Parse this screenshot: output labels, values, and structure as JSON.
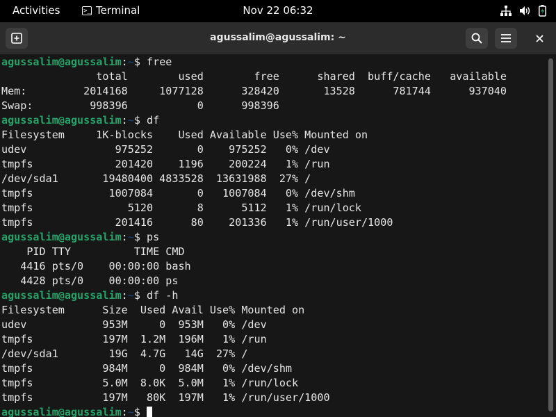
{
  "topbar": {
    "activities": "Activities",
    "app_name": "Terminal",
    "app_icon_glyph": ">_",
    "clock": "Nov 22  06:32",
    "icons": [
      "network-icon",
      "volume-icon",
      "battery-icon"
    ]
  },
  "window": {
    "title": "agussalim@agussalim: ~",
    "buttons": [
      "new-tab-icon",
      "search-icon",
      "hamburger-menu-icon",
      "close-icon"
    ]
  },
  "prompt": {
    "user_host": "agussalim@agussalim",
    "colon": ":",
    "path": "~",
    "sign": "$ "
  },
  "colors": {
    "prompt_user": "#26a269",
    "prompt_path": "#12488b",
    "terminal_bg": "#171717",
    "headerbar_bg": "#2c2c2c"
  },
  "terminal": {
    "lines": [
      {
        "type": "cmd",
        "cmd": "free"
      },
      {
        "type": "out",
        "text": "               total        used        free      shared  buff/cache   available"
      },
      {
        "type": "out",
        "text": "Mem:         2014168     1077128      328420       13528      781744      937040"
      },
      {
        "type": "out",
        "text": "Swap:         998396           0      998396"
      },
      {
        "type": "cmd",
        "cmd": "df"
      },
      {
        "type": "out",
        "text": "Filesystem     1K-blocks    Used Available Use% Mounted on"
      },
      {
        "type": "out",
        "text": "udev              975252       0    975252   0% /dev"
      },
      {
        "type": "out",
        "text": "tmpfs             201420    1196    200224   1% /run"
      },
      {
        "type": "out",
        "text": "/dev/sda1       19480400 4833528  13631988  27% /"
      },
      {
        "type": "out",
        "text": "tmpfs            1007084       0   1007084   0% /dev/shm"
      },
      {
        "type": "out",
        "text": "tmpfs               5120       8      5112   1% /run/lock"
      },
      {
        "type": "out",
        "text": "tmpfs             201416      80    201336   1% /run/user/1000"
      },
      {
        "type": "cmd",
        "cmd": "ps"
      },
      {
        "type": "out",
        "text": "    PID TTY          TIME CMD"
      },
      {
        "type": "out",
        "text": "   4416 pts/0    00:00:00 bash"
      },
      {
        "type": "out",
        "text": "   4428 pts/0    00:00:00 ps"
      },
      {
        "type": "cmd",
        "cmd": "df -h"
      },
      {
        "type": "out",
        "text": "Filesystem      Size  Used Avail Use% Mounted on"
      },
      {
        "type": "out",
        "text": "udev            953M     0  953M   0% /dev"
      },
      {
        "type": "out",
        "text": "tmpfs           197M  1.2M  196M   1% /run"
      },
      {
        "type": "out",
        "text": "/dev/sda1        19G  4.7G   14G  27% /"
      },
      {
        "type": "out",
        "text": "tmpfs           984M     0  984M   0% /dev/shm"
      },
      {
        "type": "out",
        "text": "tmpfs           5.0M  8.0K  5.0M   1% /run/lock"
      },
      {
        "type": "out",
        "text": "tmpfs           197M   80K  197M   1% /run/user/1000"
      },
      {
        "type": "cmd",
        "cmd": "",
        "cursor": true
      }
    ]
  }
}
